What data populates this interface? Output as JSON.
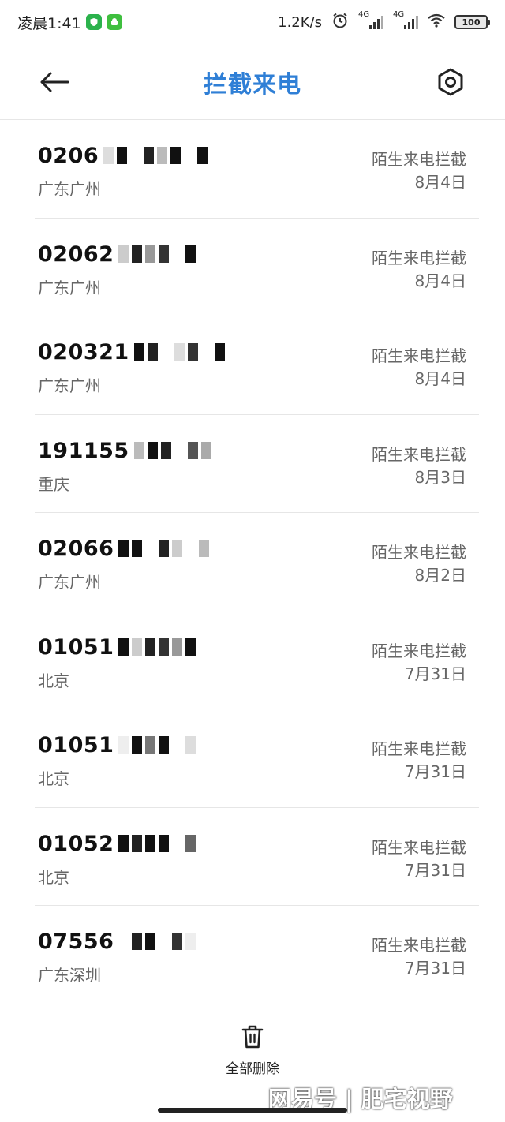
{
  "status_bar": {
    "time": "凌晨1:41",
    "net_speed": "1.2K/s",
    "sim1_label": "4G",
    "sim2_label": "4G",
    "battery": "100"
  },
  "header": {
    "title": "拦截来电"
  },
  "calls": [
    {
      "number": "0206",
      "location": "广东广州",
      "type": "陌生来电拦截",
      "date": "8月4日"
    },
    {
      "number": "02062",
      "location": "广东广州",
      "type": "陌生来电拦截",
      "date": "8月4日"
    },
    {
      "number": "020321",
      "location": "广东广州",
      "type": "陌生来电拦截",
      "date": "8月4日"
    },
    {
      "number": "191155",
      "location": "重庆",
      "type": "陌生来电拦截",
      "date": "8月3日"
    },
    {
      "number": "02066",
      "location": "广东广州",
      "type": "陌生来电拦截",
      "date": "8月2日"
    },
    {
      "number": "01051",
      "location": "北京",
      "type": "陌生来电拦截",
      "date": "7月31日"
    },
    {
      "number": "01051",
      "location": "北京",
      "type": "陌生来电拦截",
      "date": "7月31日"
    },
    {
      "number": "01052",
      "location": "北京",
      "type": "陌生来电拦截",
      "date": "7月31日"
    },
    {
      "number": "07556",
      "location": "广东深圳",
      "type": "陌生来电拦截",
      "date": "7月31日"
    }
  ],
  "footer": {
    "delete_all_label": "全部删除",
    "watermark": "网易号 | 肥宅视野"
  },
  "colors": {
    "accent": "#2f7fd6",
    "secondary_text": "#666666",
    "divider": "#e6e6e6"
  },
  "icons": {
    "back": "arrow-left-icon",
    "settings": "hexagon-gear-icon",
    "delete": "trash-icon"
  }
}
